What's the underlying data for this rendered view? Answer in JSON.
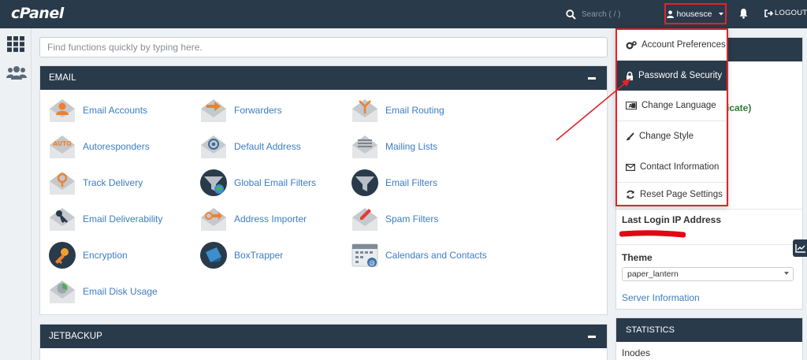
{
  "header": {
    "logo": "cPanel",
    "search_placeholder": "Search ( / )",
    "username": "housesce",
    "logout": "LOGOUT"
  },
  "find_placeholder": "Find functions quickly by typing here.",
  "email_section": {
    "title": "EMAIL",
    "items": [
      "Email Accounts",
      "Forwarders",
      "Email Routing",
      "Autoresponders",
      "Default Address",
      "Mailing Lists",
      "Track Delivery",
      "Global Email Filters",
      "Email Filters",
      "Email Deliverability",
      "Address Importer",
      "Spam Filters",
      "Encryption",
      "BoxTrapper",
      "Calendars and Contacts",
      "Email Disk Usage"
    ],
    "auto_badge": "AUTO"
  },
  "jetbackup_section": {
    "title": "JETBACKUP"
  },
  "user_menu": {
    "items": [
      "Account Preferences",
      "Password & Security",
      "Change Language",
      "Change Style",
      "Contact Information",
      "Reset Page Settings"
    ]
  },
  "right_info": {
    "partial_text": "icate)",
    "last_login_label": "Last Login IP Address",
    "theme_label": "Theme",
    "theme_value": "paper_lantern",
    "server_info_link": "Server Information",
    "statistics_title": "STATISTICS",
    "inodes_label": "Inodes"
  },
  "colors": {
    "header_bg": "#293a4a",
    "link": "#3c7dc2",
    "highlight": "#e0242a",
    "green_text": "#2e7d32"
  }
}
